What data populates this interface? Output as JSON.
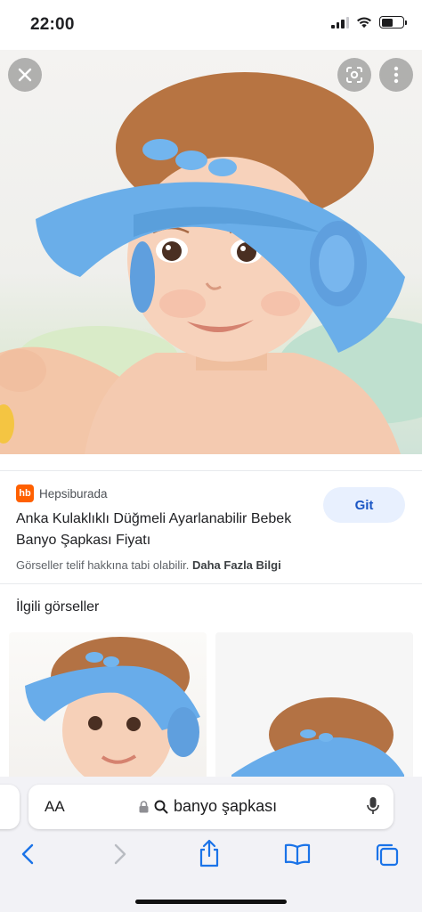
{
  "status_bar": {
    "time": "22:00"
  },
  "image_viewer": {
    "close_icon": "close-icon",
    "lens_icon": "google-lens-icon",
    "more_icon": "more-vertical-icon"
  },
  "result": {
    "source_logo_text": "hb",
    "source_name": "Hepsiburada",
    "title": "Anka Kulaklıklı Düğmeli Ayarlanabilir Bebek Banyo Şapkası Fiyatı",
    "visit_button": "Git",
    "copyright_notice": "Görseller telif hakkına tabi olabilir.",
    "learn_more": "Daha Fazla Bilgi"
  },
  "related": {
    "heading": "İlgili görseller"
  },
  "browser": {
    "text_size_label": "AA",
    "url": "banyo şapkası",
    "accent_color": "#1a73e8",
    "toolbar": [
      "back-icon",
      "forward-icon",
      "share-icon",
      "bookmarks-icon",
      "tabs-icon"
    ]
  }
}
